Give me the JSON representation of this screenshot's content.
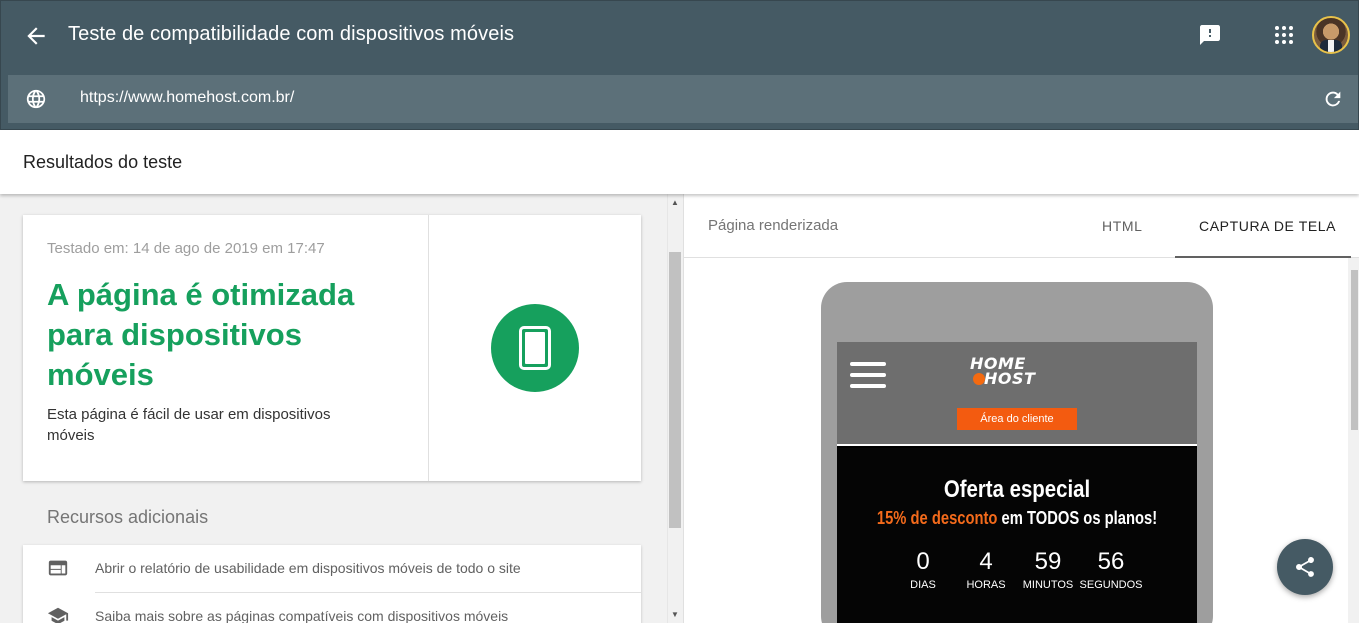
{
  "appbar": {
    "title": "Teste de compatibilidade com dispositivos móveis",
    "url": "https://www.homehost.com.br/",
    "background": "#455a64"
  },
  "results": {
    "header": "Resultados do teste",
    "tested_at": "Testado em: 14 de ago de 2019 em 17:47",
    "verdict": "A página é otimizada para dispositivos móveis",
    "description": "Esta página é fácil de usar em dispositivos móveis",
    "accent": "#16a05d"
  },
  "resources": {
    "title": "Recursos adicionais",
    "items": [
      {
        "label": "Abrir o relatório de usabilidade em dispositivos móveis de todo o site",
        "icon": "web-report-icon"
      },
      {
        "label": "Saiba mais sobre as páginas compatíveis com dispositivos móveis",
        "icon": "school-icon"
      }
    ]
  },
  "rendered": {
    "label": "Página renderizada",
    "tabs": [
      {
        "label": "HTML",
        "active": false
      },
      {
        "label": "CAPTURA DE TELA",
        "active": true
      }
    ]
  },
  "screenshot": {
    "logo_line1": "HOME",
    "logo_line2": "HOST",
    "client_button": "Área do cliente",
    "headline": "Oferta especial",
    "discount": "15% de desconto",
    "discount_rest": " em TODOS os planos!",
    "countdown": [
      {
        "value": "0",
        "unit": "DIAS"
      },
      {
        "value": "4",
        "unit": "HORAS"
      },
      {
        "value": "59",
        "unit": "MINUTOS"
      },
      {
        "value": "56",
        "unit": "SEGUNDOS"
      }
    ],
    "accent": "#f35b10"
  }
}
